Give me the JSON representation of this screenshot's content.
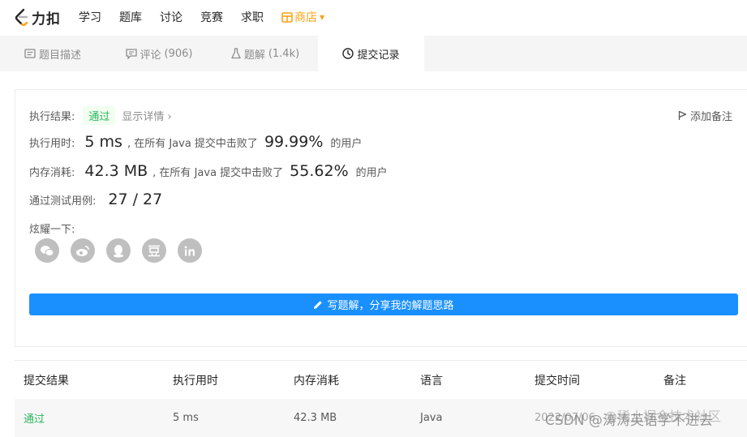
{
  "nav": {
    "logo_text": "力扣",
    "items": [
      "学习",
      "题库",
      "讨论",
      "竞赛",
      "求职"
    ],
    "store_label": "商店",
    "accent": "#ffa116"
  },
  "tabs": [
    {
      "label": "题目描述",
      "count": ""
    },
    {
      "label": "评论",
      "count": "(906)"
    },
    {
      "label": "题解",
      "count": "(1.4k)"
    },
    {
      "label": "提交记录",
      "count": ""
    }
  ],
  "result": {
    "status_label": "执行结果:",
    "status": "通过",
    "details_link": "显示详情 ›",
    "add_note": "添加备注",
    "runtime_label": "执行用时:",
    "runtime": "5 ms",
    "runtime_mid": ", 在所有 Java 提交中击败了",
    "runtime_pct": "99.99%",
    "runtime_suffix": "的用户",
    "memory_label": "内存消耗:",
    "memory": "42.3 MB",
    "memory_mid": ", 在所有 Java 提交中击败了",
    "memory_pct": "55.62%",
    "memory_suffix": "的用户",
    "tests_label": "通过测试用例:",
    "tests": "27 / 27",
    "share_label": "炫耀一下:",
    "share_icons": [
      "wechat-icon",
      "weibo-icon",
      "qq-icon",
      "douban-icon",
      "linkedin-icon"
    ],
    "write_button": "写题解，分享我的解题思路",
    "pass_color": "#2db55d",
    "button_color": "#1a90ff"
  },
  "table": {
    "headers": [
      "提交结果",
      "执行用时",
      "内存消耗",
      "语言",
      "提交时间",
      "备注"
    ],
    "rows": [
      {
        "result": "通过",
        "runtime": "5 ms",
        "memory": "42.3 MB",
        "language": "Java",
        "time": "2022/07/06"
      }
    ]
  },
  "watermark": {
    "line1": "@稀土掘金技术社区",
    "line2": "CSDN @涛涛英语学不进去"
  }
}
